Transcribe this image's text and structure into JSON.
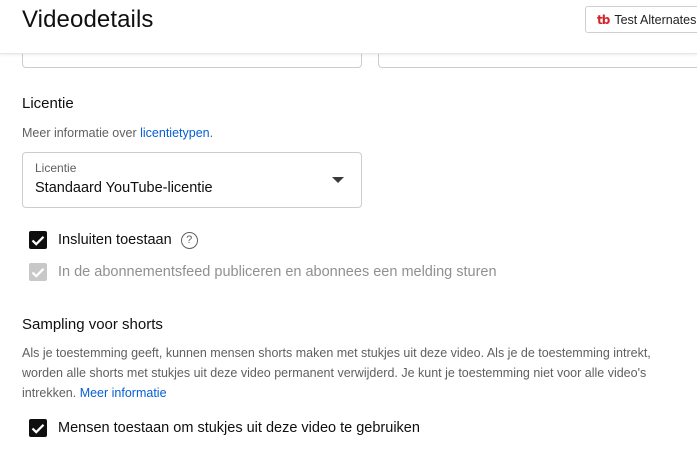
{
  "header": {
    "title": "Videodetails",
    "tubebuddy_button_label": "Test Alternates",
    "tubebuddy_logo": "tb"
  },
  "license": {
    "section_title": "Licentie",
    "info_prefix": "Meer informatie over ",
    "info_link": "licentietypen",
    "info_suffix": ".",
    "select_label": "Licentie",
    "select_value": "Standaard YouTube-licentie"
  },
  "options": {
    "embed_label": "Insluiten toestaan",
    "embed_checked": true,
    "feed_label": "In de abonnementsfeed publiceren en abonnees een melding sturen",
    "feed_checked": true,
    "feed_disabled": true
  },
  "sampling": {
    "section_title": "Sampling voor shorts",
    "description": "Als je toestemming geeft, kunnen mensen shorts maken met stukjes uit deze video. Als je de toestemming intrekt, worden alle shorts met stukjes uit deze video permanent verwijderd. Je kunt je toestemming niet voor alle video's intrekken.",
    "more_info_link": "Meer informatie",
    "allow_label": "Mensen toestaan om stukjes uit deze video te gebruiken",
    "allow_checked": true
  },
  "colors": {
    "link": "#065fd4",
    "checkbox_checked": "#0f0f0f",
    "checkbox_disabled": "#c8c8c8",
    "tubebuddy_red": "#d8232a"
  }
}
